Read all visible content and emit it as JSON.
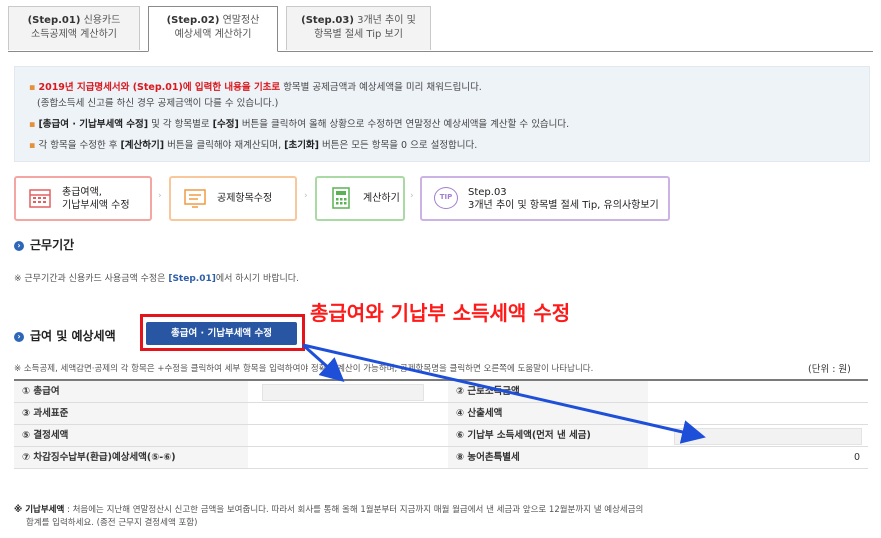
{
  "tabs": [
    {
      "step": "(Step.01)",
      "title": "신용카드",
      "line2": "소득공제액 계산하기",
      "active": false
    },
    {
      "step": "(Step.02)",
      "title": "연말정산",
      "line2": "예상세액 계산하기",
      "active": true
    },
    {
      "step": "(Step.03)",
      "title": "3개년 추이 및",
      "line2": "항목별 절세 Tip 보기",
      "active": false
    }
  ],
  "info": {
    "l1_red": "2019년 지급명세서와 (Step.01)에 입력한 내용을 기초로",
    "l1_rest": " 항목별 공제금액과 예상세액을 미리 채워드립니다.",
    "l2": "(종합소득세 신고를 하신 경우 공제금액이 다를 수 있습니다.)",
    "l3_bold1": "[총급여 · 기납부세액 수정]",
    "l3_mid": " 및 각 항목별로 ",
    "l3_bold2": "[수정]",
    "l3_rest": " 버튼을 클릭하여 올해 상황으로 수정하면 연말정산 예상세액을 계산할 수 있습니다.",
    "l4_a": "각 항목을 수정한 후 ",
    "l4_bold1": "[계산하기]",
    "l4_b": " 버튼을 클릭해야 재계산되며, ",
    "l4_bold2": "[초기화]",
    "l4_c": " 버튼은 모든 항목을 0 으로 설정합니다."
  },
  "steps": [
    {
      "l1": "총급여액,",
      "l2": "기납부세액 수정",
      "color": "#f4a7a2"
    },
    {
      "l1": "공제항목수정",
      "l2": "",
      "color": "#f8c79c"
    },
    {
      "l1": "계산하기",
      "l2": "",
      "color": "#a9d9a5"
    },
    {
      "l1": "Step.03",
      "l2": "3개년 추이 및 항목별 절세 Tip, 유의사항보기",
      "color": "#cbb4e5"
    }
  ],
  "icon_tip": "TIP",
  "work": {
    "heading": "근무기간",
    "note_a": "※ 근무기간과 신용카드 사용금액 수정은 ",
    "note_b": "[Step.01]",
    "note_c": "에서 하시기 바랍니다."
  },
  "salary": {
    "heading": "급여 및 예상세액",
    "button": "총급여 · 기납부세액 수정",
    "note": "※ 소득공제, 세액감면·공제의 각 항목은 +수정을 클릭하여 세부 항목을 입력하여야 정확한 계산이 가능하며, 공제항목명을 클릭하면 오른쪽에 도움말이 나타납니다.",
    "unit": "(단위 : 원)"
  },
  "table": [
    {
      "l": "① 총급여",
      "r": "② 근로소득금액",
      "lv": "",
      "rv": ""
    },
    {
      "l": "③ 과세표준",
      "r": "④ 산출세액",
      "lv": "",
      "rv": ""
    },
    {
      "l": "⑤ 결정세액",
      "r": "⑥ 기납부 소득세액(먼저 낸 세금)",
      "lv": "",
      "rv": ""
    },
    {
      "l": "⑦ 차감징수납부(환급)예상세액(⑤-⑥)",
      "r": "⑧ 농어촌특별세",
      "lv": "",
      "rv": "0"
    }
  ],
  "footer": {
    "bold": "※ 기납부세액",
    "l1": " : 처음에는 지난해 연말정산시 신고한 금액을 보여줍니다. 따라서 회사를 통해 올해 1월분부터 지금까지 매월 월급에서 낸 세금과 앞으로 12월분까지 낼 예상세금의",
    "l2": "합계를 입력하세요. (종전 근무지 결정세액 포함)"
  },
  "annotation": "총급여와 기납부 소득세액 수정",
  "colors": {
    "accent": "#2856a3",
    "annotation": "#ff1a1a",
    "arrow": "#1e4fd8"
  }
}
